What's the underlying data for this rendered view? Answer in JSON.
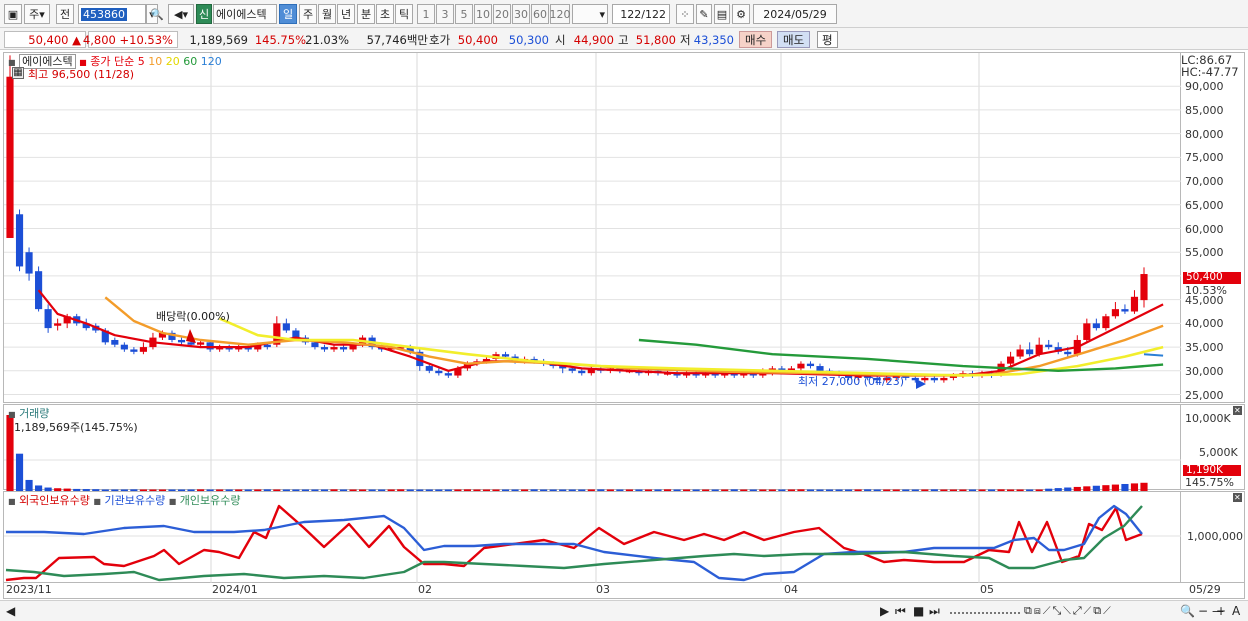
{
  "toolbar": {
    "market": "주",
    "prev": "전",
    "code_prefix": "453860",
    "stock_name": "에이에스텍",
    "credit_badge": "신",
    "periods": [
      "일",
      "주",
      "월",
      "년",
      "분",
      "초",
      "틱"
    ],
    "active_period": "일",
    "nums": [
      "1",
      "3",
      "5",
      "10",
      "20",
      "30",
      "60",
      "120"
    ],
    "count": "122",
    "count_total": "/122",
    "date": "2024/05/29"
  },
  "quote": {
    "price": "50,400 ▲",
    "change": "4,800 +10.53%",
    "volume": "1,189,569",
    "vol_ratio": "145.75%",
    "turnover": "21.03%",
    "amount": "57,746백만",
    "bid_label": "호가",
    "bid1": "50,400",
    "bid2": "50,300",
    "open_label": "시",
    "open": "44,900",
    "high_label": "고",
    "high": "51,800",
    "low_label": "저",
    "low": "43,350",
    "buy": "매수",
    "sell": "매도",
    "eval": "평"
  },
  "price_pane": {
    "name": "에이에스텍",
    "ma_label": "종가 단순",
    "ma_periods": [
      "5",
      "10",
      "20",
      "60",
      "120"
    ],
    "max_note": "최고 96,500 (11/28)",
    "min_note": "최저 27,000 (04/23)",
    "div_note": "배당락(0.00%)",
    "lc": "LC:86.67",
    "hc": "HC:-47.77",
    "yticks": [
      "90,000",
      "85,000",
      "80,000",
      "75,000",
      "70,000",
      "65,000",
      "60,000",
      "55,000",
      "50,000",
      "45,000",
      "40,000",
      "35,000",
      "30,000",
      "25,000"
    ],
    "last_tag": "50,400",
    "last_pct": "10.53%"
  },
  "volume_pane": {
    "name": "거래량",
    "note": "1,189,569주(145.75%)",
    "yticks": [
      "10,000K",
      "5,000K"
    ],
    "last_tag": "1,190K",
    "last_pct": "145.75%"
  },
  "holder_pane": {
    "foreign": "외국인보유수량",
    "inst": "기관보유수량",
    "indiv": "개인보유수량",
    "ytick": "1,000,000"
  },
  "xaxis": [
    "2023/11",
    "2024/01",
    "02",
    "03",
    "04",
    "05",
    "05/29"
  ],
  "colors": {
    "up": "#e3000b",
    "down": "#1c4fd6",
    "ma5": "#e3000b",
    "ma10": "#f39c2a",
    "ma20": "#f2ee2c",
    "ma60": "#249a3a",
    "ma120": "#2b7fd6"
  },
  "chart_data": [
    {
      "type": "candlestick",
      "title": "에이에스텍",
      "ylim": [
        23000,
        97000
      ],
      "x_range": [
        "2023/11",
        "2024/05/29"
      ],
      "candles": [
        [
          58000,
          92000,
          58000,
          96500
        ],
        [
          63000,
          52000,
          51000,
          64000
        ],
        [
          55000,
          50500,
          49000,
          56000
        ],
        [
          51000,
          43000,
          42500,
          52000
        ],
        [
          43000,
          39000,
          38000,
          44000
        ],
        [
          39500,
          40000,
          38500,
          41000
        ],
        [
          40000,
          41500,
          39000,
          42000
        ],
        [
          41500,
          40000,
          39500,
          42000
        ],
        [
          40000,
          39000,
          38500,
          41000
        ],
        [
          39500,
          38500,
          38000,
          40000
        ],
        [
          38500,
          36000,
          35500,
          39000
        ],
        [
          36500,
          35500,
          35000,
          37000
        ],
        [
          35500,
          34500,
          34000,
          36000
        ],
        [
          34500,
          34000,
          33500,
          35000
        ],
        [
          34000,
          35000,
          33500,
          36000
        ],
        [
          35000,
          37000,
          34500,
          38000
        ],
        [
          37000,
          38000,
          36500,
          38500
        ],
        [
          38000,
          36500,
          36000,
          38500
        ],
        [
          36500,
          36000,
          35500,
          37000
        ],
        [
          36000,
          35500,
          35000,
          36500
        ],
        [
          35500,
          36000,
          35000,
          36500
        ],
        [
          36000,
          34500,
          34000,
          36500
        ],
        [
          34500,
          35000,
          34000,
          35500
        ],
        [
          35000,
          34500,
          34000,
          35500
        ],
        [
          34500,
          35000,
          34000,
          35500
        ],
        [
          35000,
          34500,
          34000,
          35500
        ],
        [
          34500,
          35500,
          34000,
          36000
        ],
        [
          35500,
          35000,
          34500,
          36000
        ],
        [
          35500,
          40000,
          35000,
          41500
        ],
        [
          40000,
          38500,
          38000,
          41000
        ],
        [
          38500,
          37000,
          36500,
          39000
        ],
        [
          37000,
          36000,
          35500,
          37500
        ],
        [
          36000,
          35000,
          34500,
          36500
        ],
        [
          35000,
          34500,
          34000,
          35500
        ],
        [
          34500,
          35000,
          34000,
          35500
        ],
        [
          35000,
          34500,
          34000,
          35500
        ],
        [
          34500,
          35500,
          34000,
          36000
        ],
        [
          35500,
          37000,
          35000,
          37500
        ],
        [
          37000,
          35000,
          34500,
          37500
        ],
        [
          35000,
          34500,
          34000,
          35500
        ],
        [
          34500,
          35000,
          34000,
          35500
        ],
        [
          35000,
          35000,
          34500,
          35500
        ],
        [
          35000,
          34000,
          33500,
          35500
        ],
        [
          34000,
          31000,
          30000,
          34500
        ],
        [
          31000,
          30000,
          29500,
          31500
        ],
        [
          30000,
          29500,
          29000,
          30500
        ],
        [
          29500,
          29000,
          28500,
          30000
        ],
        [
          29000,
          30500,
          28500,
          31000
        ],
        [
          30500,
          31500,
          30000,
          32000
        ],
        [
          31500,
          32000,
          31000,
          32500
        ],
        [
          32000,
          32500,
          31500,
          33000
        ],
        [
          32500,
          33500,
          32000,
          34000
        ],
        [
          33500,
          33000,
          32500,
          34000
        ],
        [
          33000,
          32000,
          31500,
          33500
        ],
        [
          32000,
          32500,
          31500,
          33000
        ],
        [
          32500,
          32000,
          31500,
          33000
        ],
        [
          32000,
          31500,
          31000,
          32500
        ],
        [
          31500,
          31000,
          30500,
          32000
        ],
        [
          31000,
          30500,
          29500,
          31500
        ],
        [
          30500,
          30000,
          29500,
          31000
        ],
        [
          30000,
          29500,
          29000,
          30500
        ],
        [
          29500,
          30500,
          29000,
          31000
        ],
        [
          30500,
          30000,
          29500,
          31000
        ],
        [
          30000,
          30500,
          29500,
          31000
        ],
        [
          30500,
          30000,
          29500,
          31000
        ],
        [
          30000,
          30000,
          29500,
          30500
        ],
        [
          30000,
          29500,
          29000,
          30500
        ],
        [
          29500,
          30000,
          29000,
          30500
        ],
        [
          30000,
          29500,
          29000,
          30500
        ],
        [
          29500,
          29500,
          29000,
          30000
        ],
        [
          29500,
          29000,
          28500,
          30000
        ],
        [
          29000,
          29500,
          28500,
          30000
        ],
        [
          29500,
          29000,
          28500,
          30000
        ],
        [
          29000,
          29500,
          28500,
          30000
        ],
        [
          29500,
          29000,
          28500,
          30000
        ],
        [
          29000,
          29500,
          28500,
          30000
        ],
        [
          29500,
          29000,
          28500,
          30000
        ],
        [
          29000,
          29500,
          28500,
          30000
        ],
        [
          29500,
          29000,
          28500,
          30000
        ],
        [
          29000,
          29500,
          28500,
          30500
        ],
        [
          29500,
          30500,
          29000,
          31000
        ],
        [
          30500,
          30000,
          29500,
          31000
        ],
        [
          30000,
          30500,
          29500,
          31000
        ],
        [
          30500,
          31500,
          30000,
          32000
        ],
        [
          31500,
          31000,
          30500,
          32000
        ],
        [
          31000,
          30000,
          29500,
          31500
        ],
        [
          30000,
          29500,
          29000,
          30500
        ],
        [
          29500,
          29000,
          28500,
          30000
        ],
        [
          29000,
          28500,
          28000,
          29500
        ],
        [
          28500,
          29000,
          28000,
          29500
        ],
        [
          29000,
          28500,
          28000,
          29500
        ],
        [
          28500,
          28000,
          27000,
          29000
        ],
        [
          28000,
          28500,
          27500,
          29000
        ],
        [
          28500,
          29000,
          28000,
          29500
        ],
        [
          29000,
          28500,
          28000,
          29500
        ],
        [
          28500,
          28000,
          27500,
          29000
        ],
        [
          28000,
          28500,
          27500,
          29000
        ],
        [
          28500,
          28000,
          27500,
          29000
        ],
        [
          28000,
          28500,
          27500,
          29000
        ],
        [
          28500,
          29000,
          28000,
          29500
        ],
        [
          29000,
          29500,
          28500,
          30000
        ],
        [
          29500,
          29000,
          28500,
          30000
        ],
        [
          29000,
          29500,
          28500,
          30000
        ],
        [
          29500,
          29000,
          28500,
          30000
        ],
        [
          29000,
          31500,
          28800,
          32000
        ],
        [
          31500,
          33000,
          31000,
          34000
        ],
        [
          33000,
          34500,
          32500,
          35500
        ],
        [
          34500,
          33500,
          33000,
          36000
        ],
        [
          33500,
          35500,
          33000,
          37000
        ],
        [
          35500,
          35000,
          34500,
          36500
        ],
        [
          35000,
          34000,
          33500,
          36000
        ],
        [
          34000,
          33500,
          33000,
          35000
        ],
        [
          33500,
          36500,
          33000,
          37500
        ],
        [
          36500,
          40000,
          36000,
          41000
        ],
        [
          40000,
          39000,
          38500,
          41000
        ],
        [
          39000,
          41500,
          38500,
          42000
        ],
        [
          41500,
          43000,
          41000,
          44500
        ],
        [
          43000,
          42500,
          42000,
          44000
        ],
        [
          42500,
          45600,
          42000,
          47000
        ],
        [
          44900,
          50400,
          43350,
          51800
        ]
      ],
      "ma": {
        "5": [
          [
            3,
            47000
          ],
          [
            5,
            42000
          ],
          [
            8,
            40000
          ],
          [
            11,
            37500
          ],
          [
            15,
            36000
          ],
          [
            20,
            35000
          ],
          [
            25,
            35000
          ],
          [
            30,
            37000
          ],
          [
            34,
            35500
          ],
          [
            38,
            35500
          ],
          [
            42,
            33000
          ],
          [
            46,
            30000
          ],
          [
            50,
            32000
          ],
          [
            55,
            32000
          ],
          [
            60,
            30500
          ],
          [
            70,
            29500
          ],
          [
            80,
            29500
          ],
          [
            90,
            29000
          ],
          [
            100,
            29000
          ],
          [
            104,
            30000
          ],
          [
            108,
            33500
          ],
          [
            112,
            35000
          ],
          [
            115,
            38000
          ],
          [
            118,
            41000
          ],
          [
            121,
            44000
          ]
        ],
        "10": [
          [
            10,
            45500
          ],
          [
            13,
            40500
          ],
          [
            16,
            38000
          ],
          [
            20,
            36500
          ],
          [
            25,
            35500
          ],
          [
            30,
            36500
          ],
          [
            35,
            36000
          ],
          [
            40,
            35000
          ],
          [
            44,
            33000
          ],
          [
            48,
            31500
          ],
          [
            52,
            32000
          ],
          [
            58,
            31500
          ],
          [
            65,
            30500
          ],
          [
            75,
            29800
          ],
          [
            85,
            29500
          ],
          [
            95,
            29000
          ],
          [
            103,
            29200
          ],
          [
            108,
            31000
          ],
          [
            113,
            34000
          ],
          [
            117,
            36500
          ],
          [
            121,
            39500
          ]
        ],
        "20": [
          [
            22,
            41000
          ],
          [
            26,
            37500
          ],
          [
            30,
            36500
          ],
          [
            36,
            36500
          ],
          [
            42,
            35000
          ],
          [
            48,
            33500
          ],
          [
            55,
            32000
          ],
          [
            62,
            31000
          ],
          [
            70,
            30500
          ],
          [
            80,
            30000
          ],
          [
            90,
            29500
          ],
          [
            100,
            29000
          ],
          [
            106,
            29300
          ],
          [
            112,
            31000
          ],
          [
            117,
            33000
          ],
          [
            121,
            35000
          ]
        ],
        "60": [
          [
            66,
            36500
          ],
          [
            72,
            35500
          ],
          [
            80,
            33500
          ],
          [
            90,
            32500
          ],
          [
            100,
            31000
          ],
          [
            110,
            30000
          ],
          [
            116,
            30500
          ],
          [
            121,
            31300
          ]
        ],
        "120": [
          [
            119,
            33500
          ],
          [
            121,
            33200
          ]
        ]
      }
    },
    {
      "type": "bar",
      "title": "거래량",
      "ylim": [
        0,
        11000000
      ],
      "note": "1,189,569주(145.75%)",
      "values": [
        11000000,
        5400000,
        1600000,
        800000,
        500000,
        400000,
        350000,
        300000,
        280000,
        260000
      ]
    },
    {
      "type": "line",
      "series": [
        {
          "name": "외국인보유수량",
          "color": "#e3000b"
        },
        {
          "name": "기관보유수량",
          "color": "#2c5ed6"
        },
        {
          "name": "개인보유수량",
          "color": "#2e8b57"
        }
      ]
    }
  ]
}
